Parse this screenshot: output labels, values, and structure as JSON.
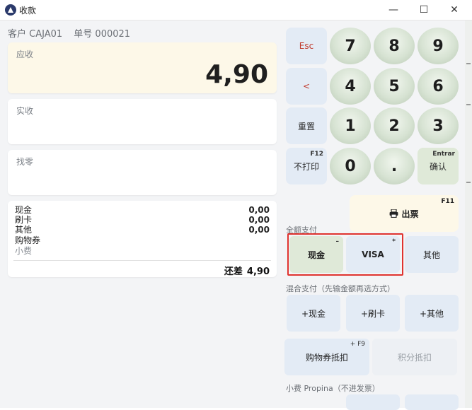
{
  "window": {
    "title": "收款",
    "minimize": "—",
    "maximize": "☐",
    "close": "✕"
  },
  "customer": {
    "label": "客户 CAJA01",
    "order": "单号 000021"
  },
  "due": {
    "label": "应收",
    "amount": "4,90"
  },
  "received": {
    "label": "实收"
  },
  "change": {
    "label": "找零"
  },
  "summary": {
    "rows": [
      {
        "label": "现金",
        "value": "0,00"
      },
      {
        "label": "刷卡",
        "value": "0,00"
      },
      {
        "label": "其他",
        "value": "0,00"
      },
      {
        "label": "购物券",
        "value": ""
      },
      {
        "label": "小费",
        "value": ""
      }
    ],
    "balance_label": "还差",
    "balance_value": "4,90"
  },
  "keypad": {
    "esc": "Esc",
    "back": "<",
    "reset": "重置",
    "noprint": "不打印",
    "noprint_hint": "F12",
    "confirm": "确认",
    "confirm_hint": "Entrar",
    "digits": [
      "7",
      "8",
      "9",
      "4",
      "5",
      "6",
      "1",
      "2",
      "3",
      "0",
      "."
    ]
  },
  "print": {
    "label": "出票",
    "hint": "F11"
  },
  "full_payment": {
    "label": "全额支付",
    "cash": "现金",
    "cash_hint": "–",
    "visa": "VISA",
    "visa_hint": "*",
    "other": "其他"
  },
  "mixed_payment": {
    "label": "混合支付（先输金额再选方式）",
    "cash": "+现金",
    "card": "+刷卡",
    "other": "+其他"
  },
  "voucher": {
    "label": "购物券抵扣",
    "hint": "+ F9",
    "points": "积分抵扣"
  },
  "tip": {
    "label": "小费 Propina（不进发票）"
  },
  "colors": {
    "accent_highlight": "#e0332f",
    "due_bg": "#fdf8e8",
    "key_bg": "#e3ebf5"
  }
}
